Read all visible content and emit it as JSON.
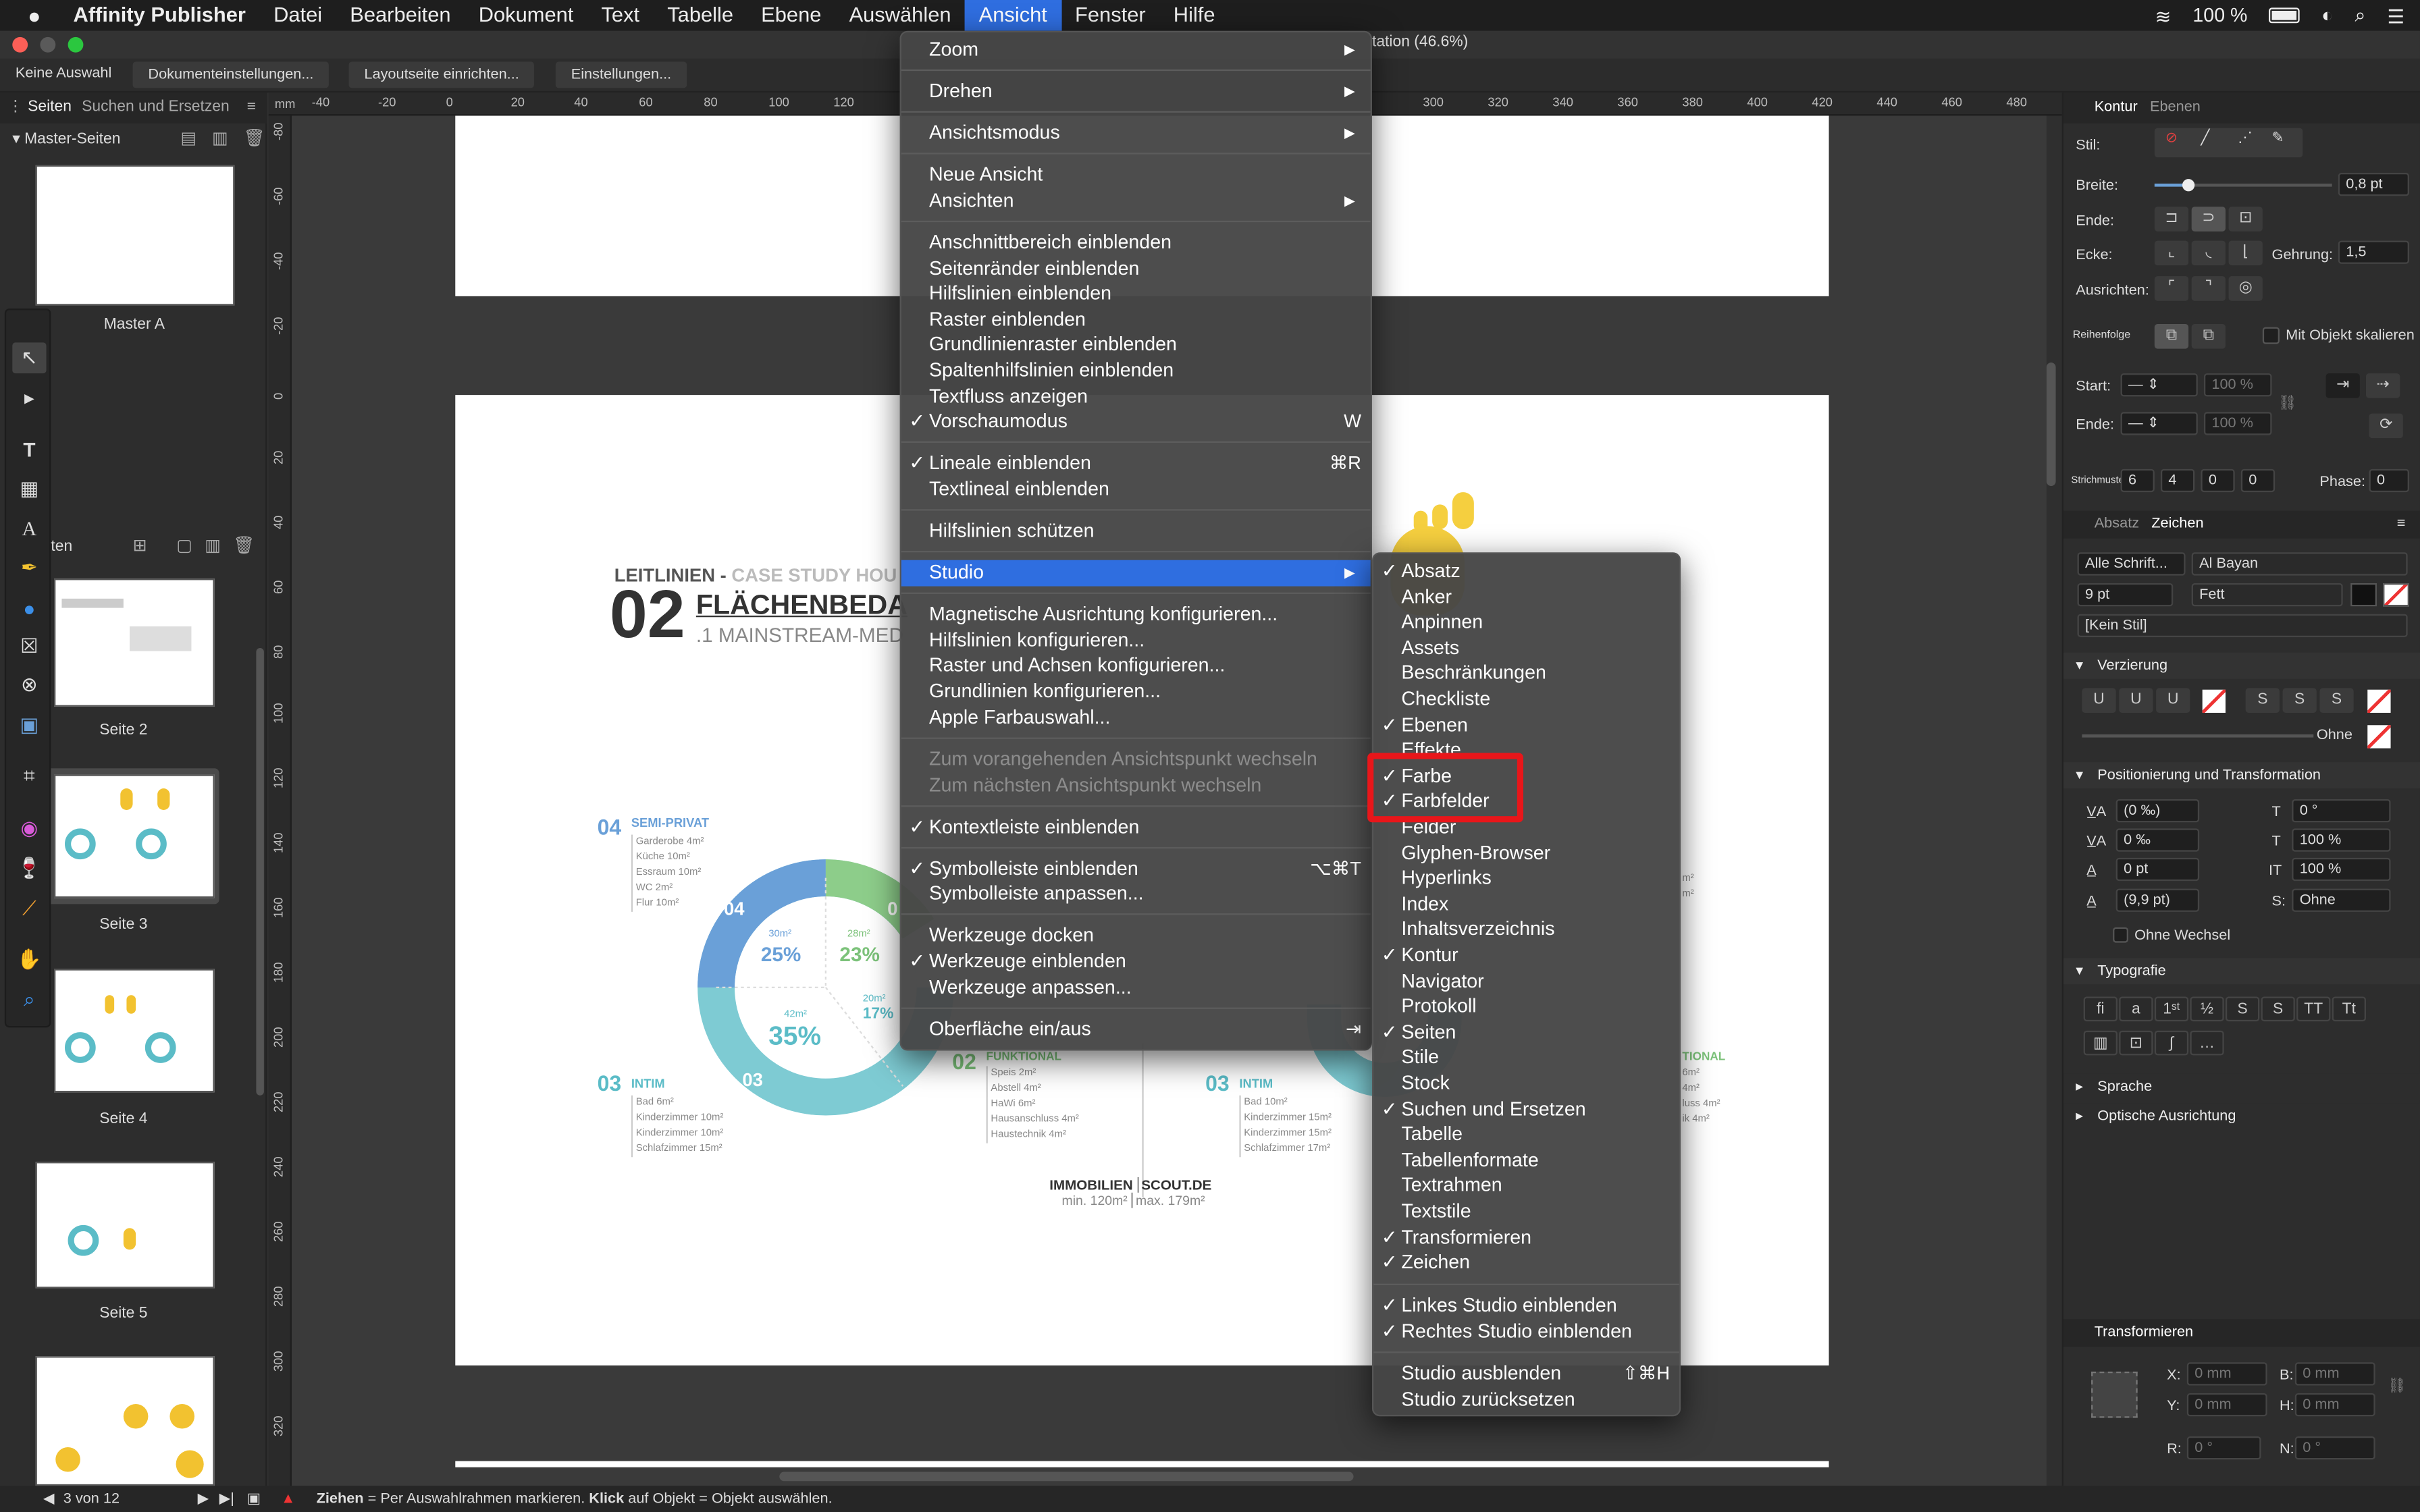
{
  "menubar": {
    "apple": "",
    "app": "Affinity Publisher",
    "items": [
      "Datei",
      "Bearbeiten",
      "Dokument",
      "Text",
      "Tabelle",
      "Ebene",
      "Auswählen",
      "Ansicht",
      "Fenster",
      "Hilfe"
    ],
    "active": "Ansicht",
    "battery": "100 %"
  },
  "window": {
    "title_fragment": "tation (46.6%)"
  },
  "context_toolbar": {
    "buttons": [
      "Keine Auswahl",
      "Dokumenteinstellungen...",
      "Layoutseite einrichten...",
      "Einstellungen..."
    ]
  },
  "left_panel": {
    "tabs": [
      "Seiten",
      "Suchen und Ersetzen"
    ],
    "master_header": "Master-Seiten",
    "master_label": "Master A",
    "pages_header": "ten",
    "pages": [
      "Seite 2",
      "Seite 3",
      "Seite 4",
      "Seite 5"
    ]
  },
  "ruler": {
    "unit": "mm",
    "h_ticks": [
      "-40",
      "-20",
      "0",
      "20",
      "40",
      "60",
      "80",
      "100",
      "120",
      "300",
      "320",
      "340",
      "360",
      "380",
      "400",
      "420",
      "440",
      "460",
      "480"
    ],
    "v_ticks": [
      "-80",
      "-60",
      "-40",
      "-20",
      "0",
      "20",
      "40",
      "60",
      "80",
      "100",
      "120",
      "140",
      "160",
      "180",
      "200",
      "220",
      "240",
      "260",
      "280",
      "300",
      "320"
    ]
  },
  "canvas": {
    "heading_small": "LEITLINIEN - ",
    "heading_small_accent": "CASE STUDY HOU",
    "big_number": "02",
    "heading_big": "FLÄCHENBEDA",
    "heading_sub": ".1 MAINSTREAM-MED",
    "seg_04": "04",
    "seg_04_title": "SEMI-PRIVAT",
    "seg_04_lines": [
      "Garderobe 4m²",
      "Küche 10m²",
      "Essraum 10m²",
      "WC 2m²",
      "Flur 10m²"
    ],
    "pct_25": "25%",
    "pct_25_small": "30m²",
    "pct_23": "23%",
    "pct_23_small": "28m²",
    "pct_35": "35%",
    "pct_35_small": "42m²",
    "pct_17": "17%",
    "pct_17_small": "20m²",
    "seg_03": "03",
    "seg_03_title": "INTIM",
    "seg_03_lines": [
      "Bad 6m²",
      "Kinderzimmer 10m²",
      "Kinderzimmer 10m²",
      "Schlafzimmer 15m²"
    ],
    "seg_02": "02",
    "seg_02_title": "FUNKTIONAL",
    "seg_02_lines": [
      "Speis 2m²",
      "Abstell 4m²",
      "HaWi 6m²",
      "Hausanschluss 4m²",
      "Haustechnik 4m²"
    ],
    "seg_03b": "03",
    "seg_03b_title": "INTIM",
    "seg_03b_lines": [
      "Bad 10m²",
      "Kinderzimmer 15m²",
      "Kinderzimmer 15m²",
      "Schlafzimmer 17m²"
    ],
    "right_title": "TIONAL",
    "right_lines": [
      "6m²",
      "4m²",
      "luss 4m²",
      "ik 4m²"
    ],
    "right_small": [
      "m²",
      "m²"
    ],
    "footer_a": "IMMOBILIEN",
    "footer_b": "SCOUT.DE",
    "footer_min": "min. 120m²",
    "footer_max": "max. 179m²",
    "seg_label_04_inner": "04",
    "seg_label_03_inner": "03",
    "seg_label_0_inner": "0"
  },
  "ansicht_menu": {
    "items": [
      {
        "label": "Zoom",
        "arrow": true
      },
      {
        "label": "Drehen",
        "arrow": true
      },
      {
        "label": "Ansichtsmodus",
        "arrow": true
      },
      {
        "label": "Neue Ansicht"
      },
      {
        "label": "Ansichten",
        "arrow": true
      },
      {
        "label": "Anschnittbereich einblenden"
      },
      {
        "label": "Seitenränder einblenden"
      },
      {
        "label": "Hilfslinien einblenden"
      },
      {
        "label": "Raster einblenden"
      },
      {
        "label": "Grundlinienraster einblenden"
      },
      {
        "label": "Spaltenhilfslinien einblenden"
      },
      {
        "label": "Textfluss anzeigen"
      },
      {
        "label": "Vorschaumodus",
        "checked": true,
        "shortcut": "W"
      },
      {
        "label": "Lineale einblenden",
        "checked": true,
        "shortcut": "⌘R"
      },
      {
        "label": "Textlineal einblenden"
      },
      {
        "label": "Hilfslinien schützen"
      },
      {
        "label": "Studio",
        "arrow": true,
        "highlighted": true
      },
      {
        "label": "Magnetische Ausrichtung konfigurieren..."
      },
      {
        "label": "Hilfslinien konfigurieren..."
      },
      {
        "label": "Raster und Achsen konfigurieren..."
      },
      {
        "label": "Grundlinien konfigurieren..."
      },
      {
        "label": "Apple Farbauswahl..."
      },
      {
        "label": "Zum vorangehenden Ansichtspunkt wechseln",
        "disabled": true
      },
      {
        "label": "Zum nächsten Ansichtspunkt wechseln",
        "disabled": true
      },
      {
        "label": "Kontextleiste einblenden",
        "checked": true
      },
      {
        "label": "Symbolleiste einblenden",
        "checked": true,
        "shortcut": "⌥⌘T"
      },
      {
        "label": "Symbolleiste anpassen..."
      },
      {
        "label": "Werkzeuge docken"
      },
      {
        "label": "Werkzeuge einblenden",
        "checked": true
      },
      {
        "label": "Werkzeuge anpassen..."
      },
      {
        "label": "Oberfläche ein/aus",
        "shortcut": "⇥"
      }
    ]
  },
  "studio_menu": {
    "items": [
      {
        "label": "Absatz",
        "checked": true
      },
      {
        "label": "Anker"
      },
      {
        "label": "Anpinnen"
      },
      {
        "label": "Assets"
      },
      {
        "label": "Beschränkungen"
      },
      {
        "label": "Checkliste"
      },
      {
        "label": "Ebenen",
        "checked": true
      },
      {
        "label": "Effekte"
      },
      {
        "label": "Farbe",
        "checked": true
      },
      {
        "label": "Farbfelder",
        "checked": true
      },
      {
        "label": "Felder"
      },
      {
        "label": "Glyphen-Browser"
      },
      {
        "label": "Hyperlinks"
      },
      {
        "label": "Index"
      },
      {
        "label": "Inhaltsverzeichnis"
      },
      {
        "label": "Kontur",
        "checked": true
      },
      {
        "label": "Navigator"
      },
      {
        "label": "Protokoll"
      },
      {
        "label": "Seiten",
        "checked": true
      },
      {
        "label": "Stile"
      },
      {
        "label": "Stock"
      },
      {
        "label": "Suchen und Ersetzen",
        "checked": true
      },
      {
        "label": "Tabelle"
      },
      {
        "label": "Tabellenformate"
      },
      {
        "label": "Textrahmen"
      },
      {
        "label": "Textstile"
      },
      {
        "label": "Transformieren",
        "checked": true
      },
      {
        "label": "Zeichen",
        "checked": true
      },
      {
        "label": "Linkes Studio einblenden",
        "checked": true
      },
      {
        "label": "Rechtes Studio einblenden",
        "checked": true
      },
      {
        "label": "Studio ausblenden",
        "shortcut": "⇧⌘H"
      },
      {
        "label": "Studio zurücksetzen"
      }
    ]
  },
  "right_panel": {
    "tabs": [
      "Kontur",
      "Ebenen"
    ],
    "stil": "Stil:",
    "breite": "Breite:",
    "breite_val": "0,8 pt",
    "ende": "Ende:",
    "ecke": "Ecke:",
    "gehrung": "Gehrung:",
    "gehrung_val": "1,5",
    "ausrichten": "Ausrichten:",
    "reihenfolge": "Reihenfolge",
    "mit_objekt": "Mit Objekt skalieren",
    "start": "Start:",
    "ende2": "Ende:",
    "pct": "100 %",
    "strichmuster": "Strichmuster",
    "dash": [
      "6",
      "4",
      "0",
      "0"
    ],
    "phase": "Phase:",
    "phase_val": "0",
    "tabs2": [
      "Absatz",
      "Zeichen"
    ],
    "font_coll": "Alle Schrift...",
    "font": "Al Bayan",
    "size": "9 pt",
    "weight": "Fett",
    "style": "[Kein Stil]",
    "verzierung": "Verzierung",
    "ohne": "Ohne",
    "pos": "Positionierung und Transformation",
    "pos_vals": [
      "(0 ‰)",
      "0 ‰",
      "0 pt",
      "(9,9 pt)"
    ],
    "pos_vals_r": [
      "0 °",
      "100 %",
      "100 %",
      "Ohne"
    ],
    "ohne_wechsel": "Ohne Wechsel",
    "typografie": "Typografie",
    "sprache": "Sprache",
    "optische": "Optische Ausrichtung",
    "transformieren": "Transformieren",
    "tx": "X:",
    "ty": "Y:",
    "tb": "B:",
    "th": "H:",
    "tr": "R:",
    "tn": "N:",
    "mm": "0 mm",
    "deg": "0 °"
  },
  "status": {
    "pager": "3 von 12",
    "hint_b1": "Ziehen",
    "hint_1": " = Per Auswahlrahmen markieren. ",
    "hint_b2": "Klick",
    "hint_2": " auf Objekt = Objekt auswählen."
  },
  "colors": {
    "accent": "#2f6ee0",
    "teal": "#5bbcc7",
    "green": "#7cc27a",
    "yellow": "#f2c230",
    "blue": "#6aa0d8",
    "highlight_box": "#e8161a"
  }
}
